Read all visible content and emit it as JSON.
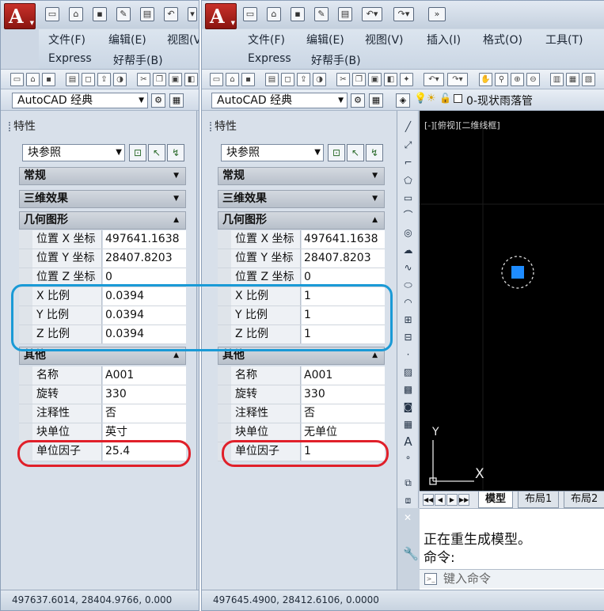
{
  "left": {
    "menu": {
      "file": "文件(F)",
      "edit": "编辑(E)",
      "view": "视图(V",
      "express": "Express",
      "helper": "好帮手(B)"
    },
    "workspace": "AutoCAD 经典",
    "palette": {
      "title": "特性",
      "selector": "块参照",
      "sections": {
        "general": "常规",
        "effects3d": "三维效果",
        "geometry": "几何图形",
        "misc": "其他"
      },
      "geometry": [
        {
          "k": "位置 X 坐标",
          "v": "497641.1638"
        },
        {
          "k": "位置 Y 坐标",
          "v": "28407.8203"
        },
        {
          "k": "位置 Z 坐标",
          "v": "0"
        },
        {
          "k": "X 比例",
          "v": "0.0394"
        },
        {
          "k": "Y 比例",
          "v": "0.0394"
        },
        {
          "k": "Z 比例",
          "v": "0.0394"
        }
      ],
      "misc": [
        {
          "k": "名称",
          "v": "A001"
        },
        {
          "k": "旋转",
          "v": "330"
        },
        {
          "k": "注释性",
          "v": "否"
        },
        {
          "k": "块单位",
          "v": "英寸"
        },
        {
          "k": "单位因子",
          "v": "25.4"
        }
      ]
    },
    "status": "497637.6014, 28404.9766, 0.000"
  },
  "right": {
    "menu": {
      "file": "文件(F)",
      "edit": "编辑(E)",
      "view": "视图(V)",
      "insert": "插入(I)",
      "format": "格式(O)",
      "tools": "工具(T)",
      "express": "Express",
      "helper": "好帮手(B)"
    },
    "workspace": "AutoCAD 经典",
    "layer": "0-现状雨落管",
    "palette": {
      "title": "特性",
      "selector": "块参照",
      "sections": {
        "general": "常规",
        "effects3d": "三维效果",
        "geometry": "几何图形",
        "misc": "其他"
      },
      "geometry": [
        {
          "k": "位置 X 坐标",
          "v": "497641.1638"
        },
        {
          "k": "位置 Y 坐标",
          "v": "28407.8203"
        },
        {
          "k": "位置 Z 坐标",
          "v": "0"
        },
        {
          "k": "X 比例",
          "v": "1"
        },
        {
          "k": "Y 比例",
          "v": "1"
        },
        {
          "k": "Z 比例",
          "v": "1"
        }
      ],
      "misc": [
        {
          "k": "名称",
          "v": "A001"
        },
        {
          "k": "旋转",
          "v": "330"
        },
        {
          "k": "注释性",
          "v": "否"
        },
        {
          "k": "块单位",
          "v": "无单位"
        },
        {
          "k": "单位因子",
          "v": "1"
        }
      ]
    },
    "viewport_label": "[-][俯视][二维线框]",
    "ucs": {
      "x": "X",
      "y": "Y"
    },
    "tabs": {
      "model": "模型",
      "layout1": "布局1",
      "layout2": "布局2"
    },
    "command": {
      "line1": "正在重生成模型。",
      "line2": "命令:",
      "input_placeholder": "键入命令"
    },
    "status": "497645.4900, 28412.6106, 0.0000"
  },
  "colors": {
    "highlight_blue": "#1a9ad6",
    "highlight_red": "#e0202a",
    "marker": "#1e8cff"
  }
}
